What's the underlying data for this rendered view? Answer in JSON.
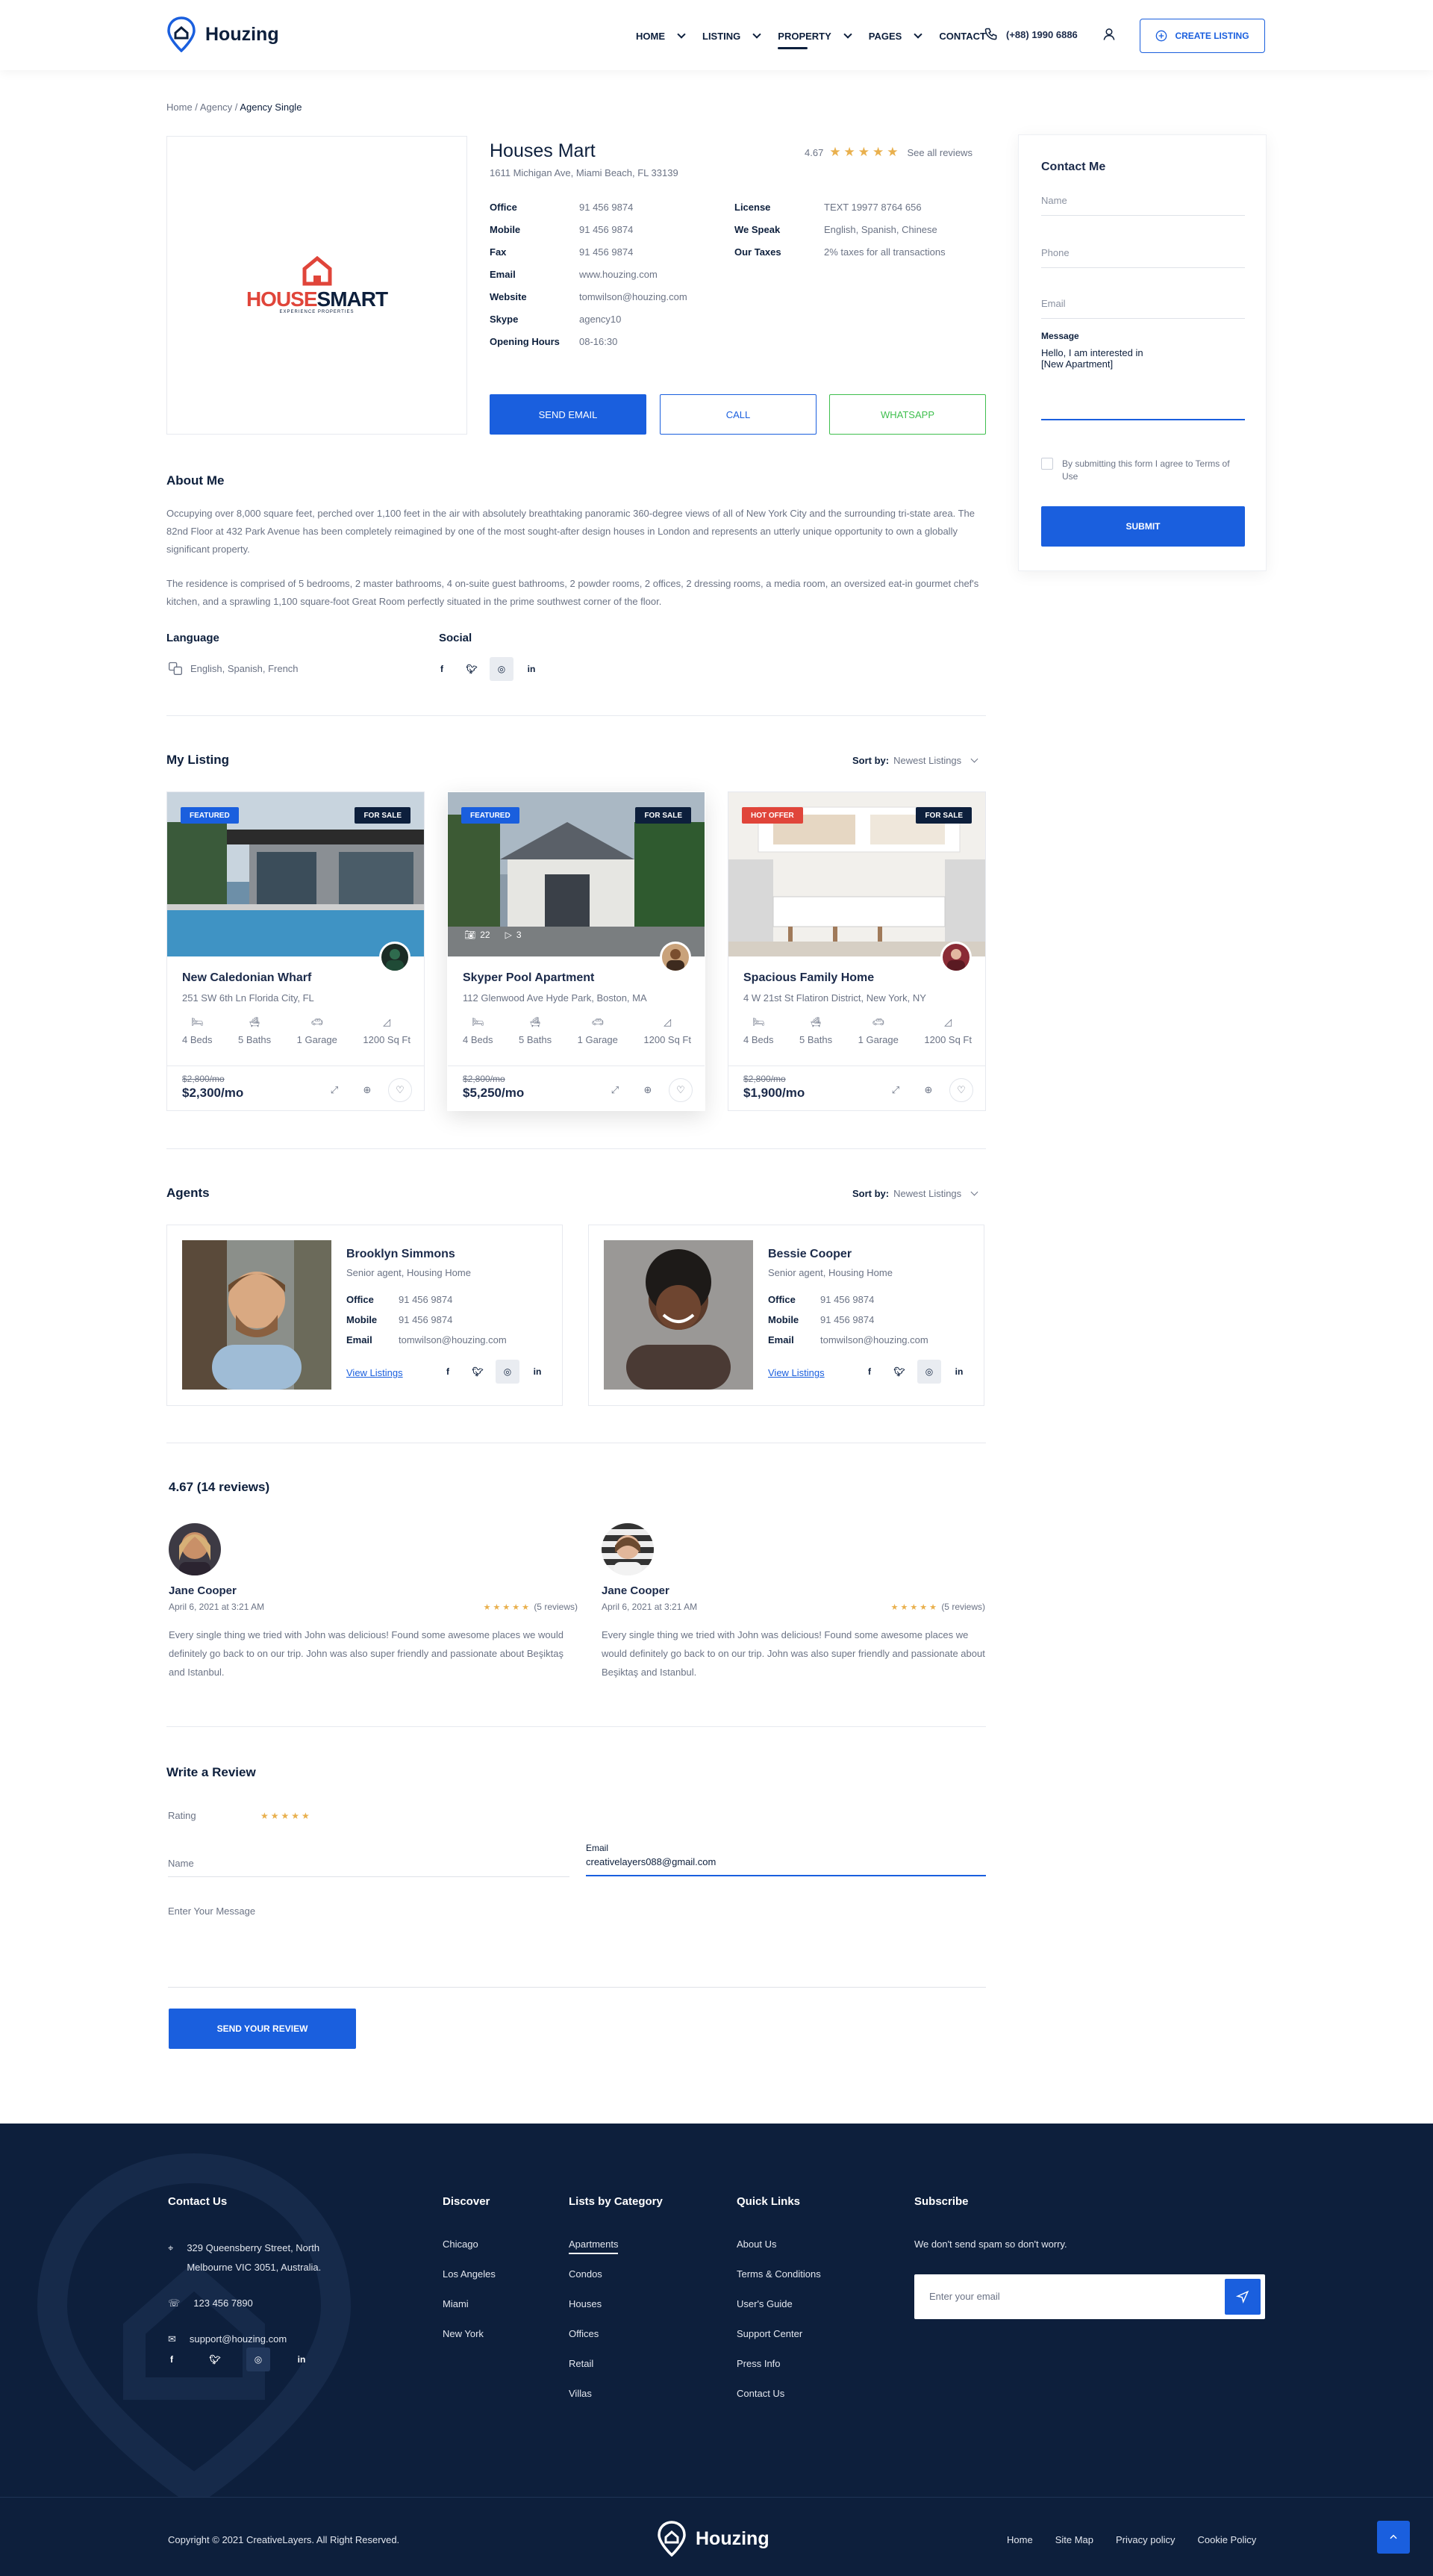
{
  "header": {
    "logo_text": "Houzing",
    "nav": [
      "HOME",
      "LISTING",
      "PROPERTY",
      "PAGES",
      "CONTACT"
    ],
    "phone": "(+88) 1990 6886",
    "create_listing": "CREATE LISTING"
  },
  "breadcrumb": {
    "home": "Home",
    "sep": " / ",
    "agency": "Agency",
    "current": "Agency Single"
  },
  "agency": {
    "logo_main_a": "HOUSE",
    "logo_main_b": "SMART",
    "logo_sub": "EXPERIENCE PROPERTIES",
    "name": "Houses Mart",
    "address": "1611 Michigan Ave, Miami Beach, FL 33139",
    "rating": "4.67",
    "see_reviews": "See all reviews",
    "info_left": [
      {
        "k": "Office",
        "v": "91 456 9874"
      },
      {
        "k": "Mobile",
        "v": "91 456 9874"
      },
      {
        "k": "Fax",
        "v": "91 456 9874"
      },
      {
        "k": "Email",
        "v": "www.houzing.com"
      },
      {
        "k": "Website",
        "v": "tomwilson@houzing.com"
      },
      {
        "k": "Skype",
        "v": "agency10"
      },
      {
        "k": "Opening Hours",
        "v": "08-16:30"
      }
    ],
    "info_right": [
      {
        "k": "License",
        "v": "TEXT 19977 8764 656"
      },
      {
        "k": "We Speak",
        "v": "English, Spanish, Chinese"
      },
      {
        "k": "Our Taxes",
        "v": "2% taxes for all transactions"
      }
    ],
    "btn_email": "SEND EMAIL",
    "btn_call": "CALL",
    "btn_whatsapp": "WHATSAPP"
  },
  "contact_form": {
    "title": "Contact Me",
    "name": "Name",
    "phone": "Phone",
    "email": "Email",
    "message_label": "Message",
    "message_value_1": "Hello, I am interested in",
    "message_value_2": "[New Apartment]",
    "terms": "By submitting this form I agree to Terms of Use",
    "submit": "SUBMIT"
  },
  "about": {
    "title": "About Me",
    "p1": "Occupying over 8,000 square feet, perched over 1,100 feet in the air with absolutely breathtaking panoramic 360-degree views of all of New York City and the surrounding tri-state area. The 82nd Floor at 432 Park Avenue has been completely reimagined by one of the most sought-after design houses in London and represents an utterly unique opportunity to own a globally significant property.",
    "p2": "The residence is comprised of 5 bedrooms, 2 master bathrooms, 4 on-suite guest bathrooms, 2 powder rooms, 2 offices, 2 dressing rooms, a media room, an oversized eat-in gourmet chef's kitchen, and a sprawling 1,100 square-foot Great Room perfectly situated in the prime southwest corner of the floor.",
    "language_title": "Language",
    "language_value": "English, Spanish, French",
    "social_title": "Social"
  },
  "listing": {
    "title": "My Listing",
    "sort_label": "Sort by:",
    "sort_value": "Newest Listings",
    "cards": [
      {
        "badge1": "FEATURED",
        "badge2": "FOR SALE",
        "title": "New Caledonian Wharf",
        "addr": "251 SW 6th Ln Florida City, FL",
        "beds": "4 Beds",
        "baths": "5 Baths",
        "garage": "1 Garage",
        "area": "1200 Sq Ft",
        "old": "$2,800/mo",
        "price": "$2,300/mo"
      },
      {
        "badge1": "FEATURED",
        "badge2": "FOR SALE",
        "title": "Skyper Pool Apartment",
        "addr": "112 Glenwood Ave Hyde Park, Boston, MA",
        "beds": "4 Beds",
        "baths": "5 Baths",
        "garage": "1 Garage",
        "area": "1200 Sq Ft",
        "old": "$2,800/mo",
        "price": "$5,250/mo",
        "photos": "22",
        "videos": "3"
      },
      {
        "badge1": "HOT OFFER",
        "badge2": "FOR SALE",
        "title": "Spacious Family Home",
        "addr": "4 W 21st St Flatiron District, New York, NY",
        "beds": "4 Beds",
        "baths": "5 Baths",
        "garage": "1 Garage",
        "area": "1200 Sq Ft",
        "old": "$2,800/mo",
        "price": "$1,900/mo"
      }
    ]
  },
  "agents": {
    "title": "Agents",
    "sort_label": "Sort by:",
    "sort_value": "Newest Listings",
    "list": [
      {
        "name": "Brooklyn Simmons",
        "role": "Senior agent, Housing Home",
        "office": "91 456 9874",
        "mobile": "91 456 9874",
        "email": "tomwilson@houzing.com",
        "link": "View Listings"
      },
      {
        "name": "Bessie Cooper",
        "role": "Senior agent, Housing Home",
        "office": "91 456 9874",
        "mobile": "91 456 9874",
        "email": "tomwilson@houzing.com",
        "link": "View Listings"
      }
    ],
    "k_office": "Office",
    "k_mobile": "Mobile",
    "k_email": "Email"
  },
  "reviews": {
    "title": "4.67 (14 reviews)",
    "list": [
      {
        "name": "Jane Cooper",
        "date": "April 6, 2021 at 3:21 AM",
        "count": "(5 reviews)",
        "text": "Every single thing we tried with John was delicious! Found some awesome places we would definitely go back to on our trip. John was also super friendly and passionate about Beşiktaş and Istanbul."
      },
      {
        "name": "Jane Cooper",
        "date": "April 6, 2021 at 3:21 AM",
        "count": "(5 reviews)",
        "text": "Every single thing we tried with John was delicious! Found some awesome places we would definitely go back to on our trip. John was also super friendly and passionate about Beşiktaş and Istanbul."
      }
    ]
  },
  "write_review": {
    "title": "Write a Review",
    "rating_label": "Rating",
    "name_placeholder": "Name",
    "email_label": "Email",
    "email_value": "creativelayers088@gmail.com",
    "message_placeholder": "Enter Your Message",
    "submit": "SEND YOUR REVIEW"
  },
  "footer": {
    "contact_title": "Contact Us",
    "address": "329 Queensberry Street, North Melbourne VIC 3051, Australia.",
    "phone": "123 456 7890",
    "email": "support@houzing.com",
    "discover_title": "Discover",
    "discover": [
      "Chicago",
      "Los Angeles",
      "Miami",
      "New York"
    ],
    "category_title": "Lists by Category",
    "categories": [
      "Apartments",
      "Condos",
      "Houses",
      "Offices",
      "Retail",
      "Villas"
    ],
    "quick_title": "Quick Links",
    "quick": [
      "About Us",
      "Terms & Conditions",
      "User's Guide",
      "Support Center",
      "Press Info",
      "Contact Us"
    ],
    "subscribe_title": "Subscribe",
    "subscribe_text": "We don't send spam so don't worry.",
    "subscribe_placeholder": "Enter your email",
    "copyright": "Copyright © 2021 CreativeLayers. All Right Reserved.",
    "logo_text": "Houzing",
    "bottom_links": [
      "Home",
      "Site Map",
      "Privacy policy",
      "Cookie Policy"
    ]
  },
  "colors": {
    "primary": "#1a5fde",
    "dark": "#0d1f3c",
    "whatsapp": "#3fbf4e",
    "star": "#e9b04d",
    "hot": "#e0453a"
  }
}
